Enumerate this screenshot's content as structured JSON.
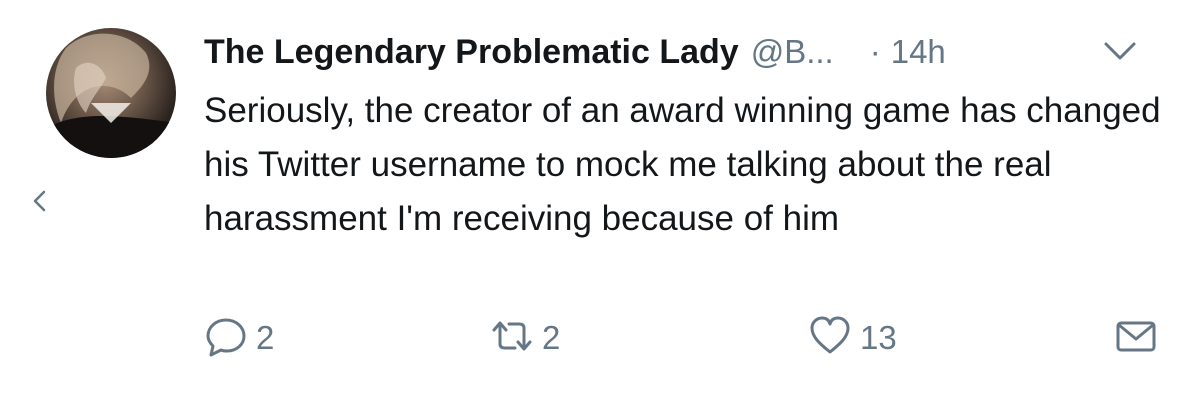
{
  "tweet": {
    "author_name": "The Legendary Problematic Lady",
    "handle": "@B...",
    "separator": "·",
    "time": "14h",
    "text": "Seriously, the creator of an award winning game has changed his Twitter username to mock me talking about the real harassment I'm receiving because of him"
  },
  "actions": {
    "reply_count": "2",
    "retweet_count": "2",
    "like_count": "13"
  },
  "icons": {
    "back": "chevron-left-icon",
    "more": "chevron-down-icon",
    "reply": "reply-icon",
    "retweet": "retweet-icon",
    "like": "heart-icon",
    "dm": "envelope-icon"
  },
  "colors": {
    "text": "#14171a",
    "secondary": "#657786",
    "background": "#ffffff"
  }
}
